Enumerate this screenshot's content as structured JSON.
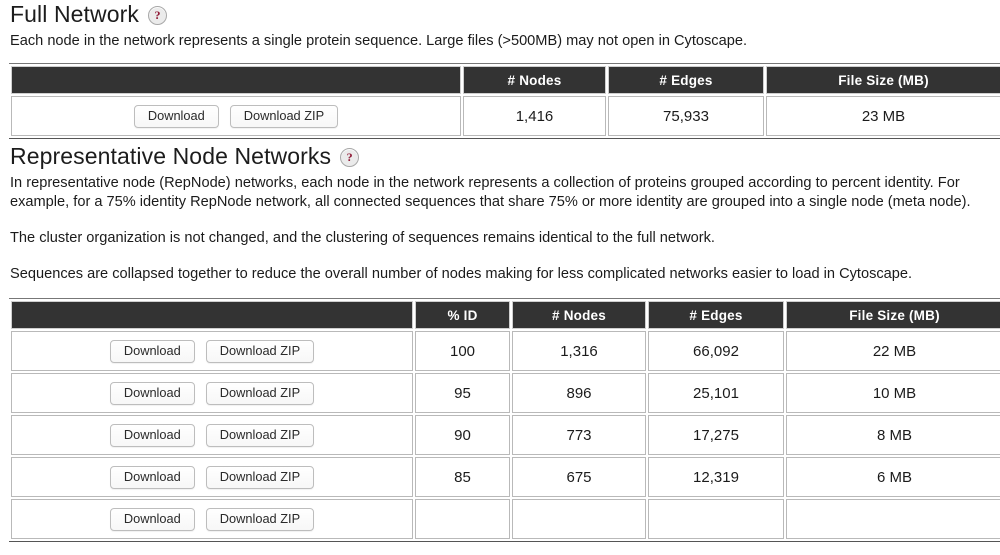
{
  "full_network": {
    "heading": "Full Network",
    "help_icon": "help-question-icon",
    "help_label": "?",
    "description": "Each node in the network represents a single protein sequence. Large files (>500MB) may not open in Cytoscape.",
    "table": {
      "columns": [
        "",
        "# Nodes",
        "# Edges",
        "File Size (MB)"
      ],
      "rows": [
        {
          "download_label": "Download",
          "download_zip_label": "Download ZIP",
          "nodes": "1,416",
          "edges": "75,933",
          "file_size": "23 MB"
        }
      ]
    }
  },
  "repnode": {
    "heading": "Representative Node Networks",
    "help_icon": "help-question-icon",
    "help_label": "?",
    "paragraph_1": "In representative node (RepNode) networks, each node in the network represents a collection of proteins grouped according to percent identity. For example, for a 75% identity RepNode network, all connected sequences that share 75% or more identity are grouped into a single node (meta node).",
    "paragraph_2": "The cluster organization is not changed, and the clustering of sequences remains identical to the full network.",
    "paragraph_3": "Sequences are collapsed together to reduce the overall number of nodes making for less complicated networks easier to load in Cytoscape.",
    "table": {
      "columns": [
        "",
        "% ID",
        "# Nodes",
        "# Edges",
        "File Size (MB)"
      ],
      "rows": [
        {
          "download_label": "Download",
          "download_zip_label": "Download ZIP",
          "percent_id": "100",
          "nodes": "1,316",
          "edges": "66,092",
          "file_size": "22 MB"
        },
        {
          "download_label": "Download",
          "download_zip_label": "Download ZIP",
          "percent_id": "95",
          "nodes": "896",
          "edges": "25,101",
          "file_size": "10 MB"
        },
        {
          "download_label": "Download",
          "download_zip_label": "Download ZIP",
          "percent_id": "90",
          "nodes": "773",
          "edges": "17,275",
          "file_size": "8 MB"
        },
        {
          "download_label": "Download",
          "download_zip_label": "Download ZIP",
          "percent_id": "85",
          "nodes": "675",
          "edges": "12,319",
          "file_size": "6 MB"
        },
        {
          "download_label": "Download",
          "download_zip_label": "Download ZIP",
          "percent_id": "",
          "nodes": "",
          "edges": "",
          "file_size": ""
        }
      ]
    }
  },
  "colors": {
    "header_bg": "#333333",
    "help_icon_mark": "#8c1330",
    "page_bg": "#ffffff",
    "cell_border": "#b9b9b9"
  }
}
